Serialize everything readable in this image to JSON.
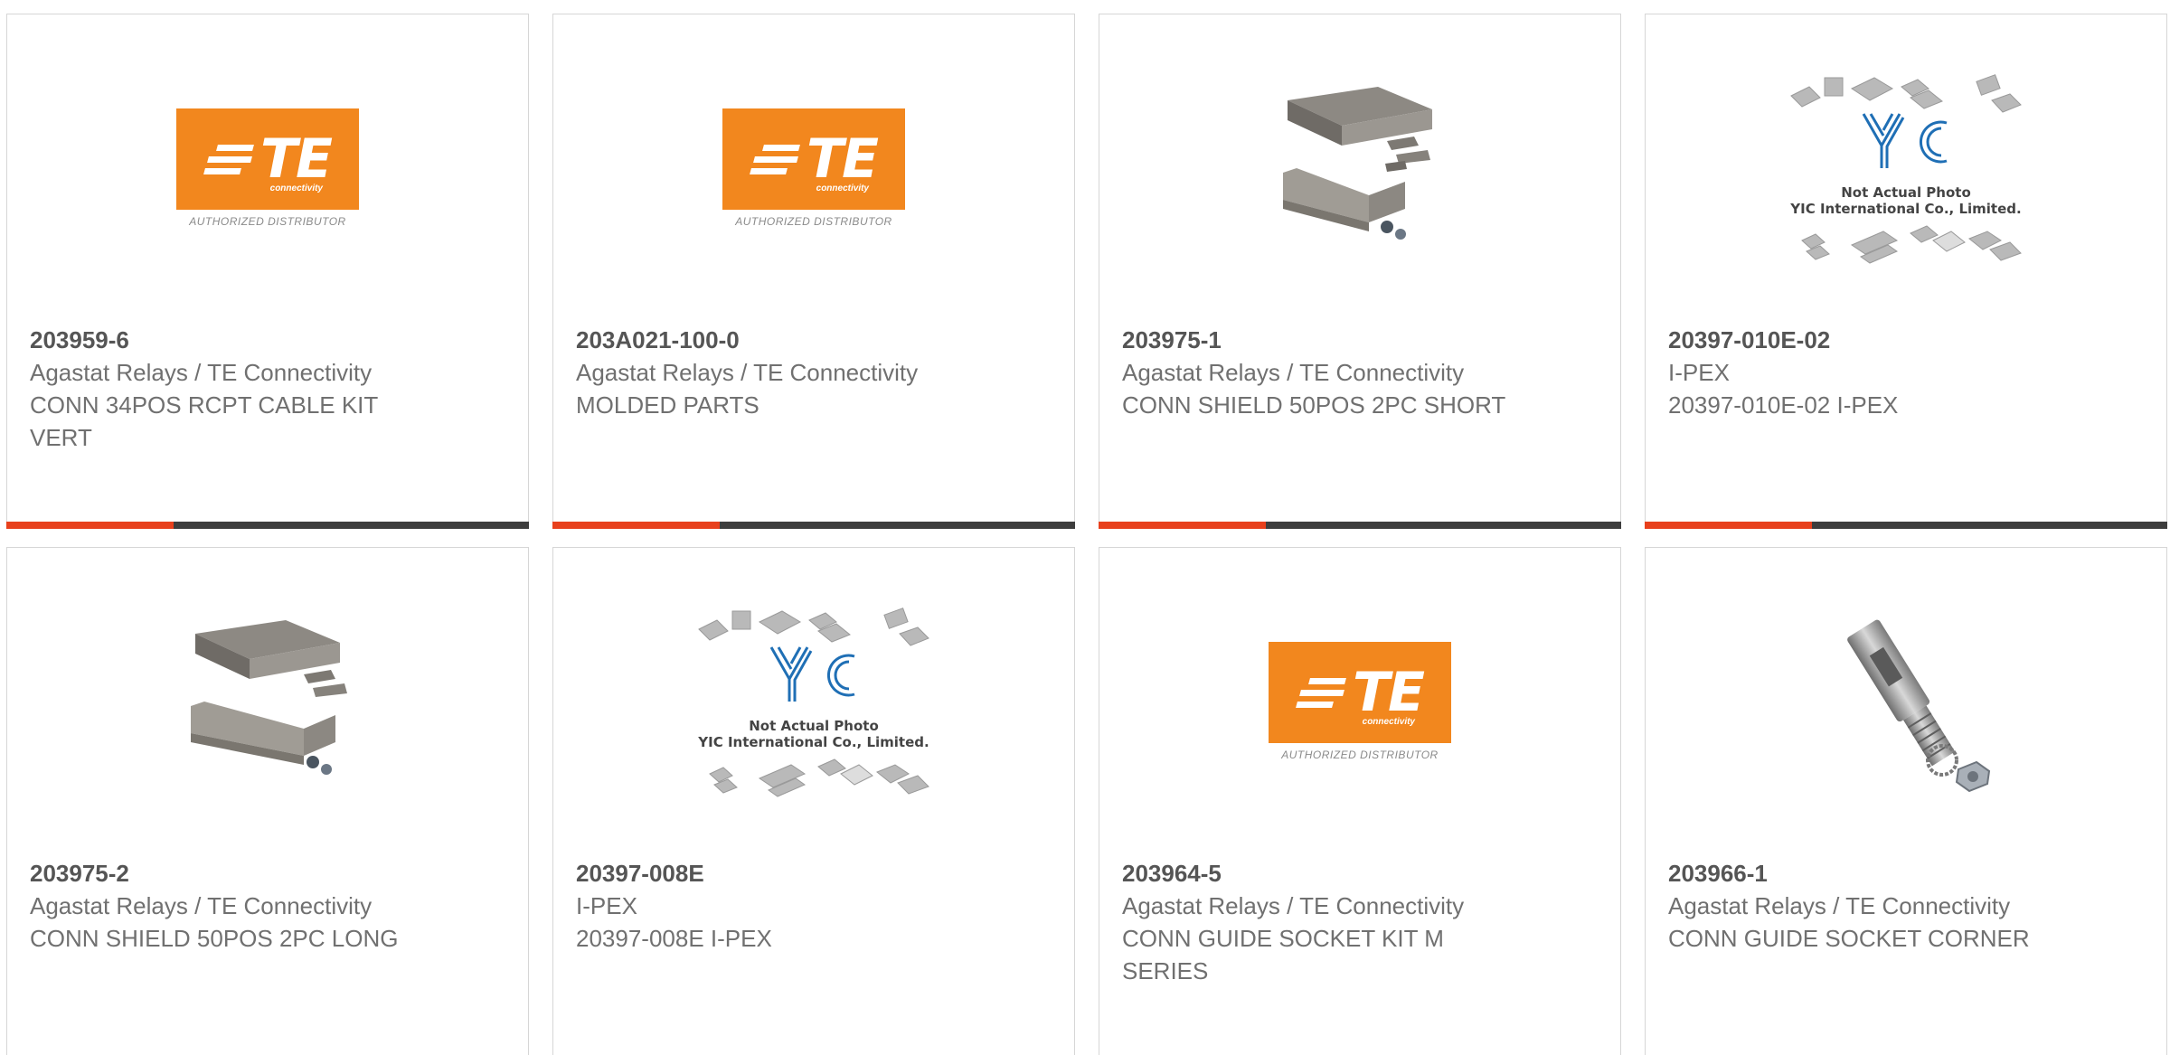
{
  "products": [
    {
      "part": "203959-6",
      "manufacturer": "Agastat Relays / TE Connectivity",
      "description": "CONN 34POS RCPT CABLE KIT VERT",
      "image": "te-authorized-distributor-logo"
    },
    {
      "part": "203A021-100-0",
      "manufacturer": "Agastat Relays / TE Connectivity",
      "description": "MOLDED PARTS",
      "image": "te-authorized-distributor-logo"
    },
    {
      "part": "203975-1",
      "manufacturer": "Agastat Relays / TE Connectivity",
      "description": "CONN SHIELD 50POS 2PC SHORT",
      "image": "shield-kit-photo"
    },
    {
      "part": "20397-010E-02",
      "manufacturer": "I-PEX",
      "description": "20397-010E-02 I-PEX",
      "image": "yic-placeholder"
    },
    {
      "part": "203975-2",
      "manufacturer": "Agastat Relays / TE Connectivity",
      "description": "CONN SHIELD 50POS 2PC LONG",
      "image": "shield-kit-photo"
    },
    {
      "part": "20397-008E",
      "manufacturer": "I-PEX",
      "description": "20397-008E I-PEX",
      "image": "yic-placeholder"
    },
    {
      "part": "203964-5",
      "manufacturer": "Agastat Relays / TE Connectivity",
      "description": "CONN GUIDE SOCKET KIT M SERIES",
      "image": "te-authorized-distributor-logo"
    },
    {
      "part": "203966-1",
      "manufacturer": "Agastat Relays / TE Connectivity",
      "description": "CONN GUIDE SOCKET CORNER",
      "image": "guide-socket-photo"
    }
  ],
  "te_logo": {
    "letters": "TE",
    "subtext": "connectivity",
    "tagline": "AUTHORIZED DISTRIBUTOR"
  },
  "yic_placeholder": {
    "line1": "Not Actual Photo",
    "line2": "YIC International Co., Limited."
  },
  "colors": {
    "accent": "#e8401c",
    "bar": "#3d3d3d",
    "te_orange": "#f2871e",
    "yic_blue": "#1f6fb5"
  }
}
